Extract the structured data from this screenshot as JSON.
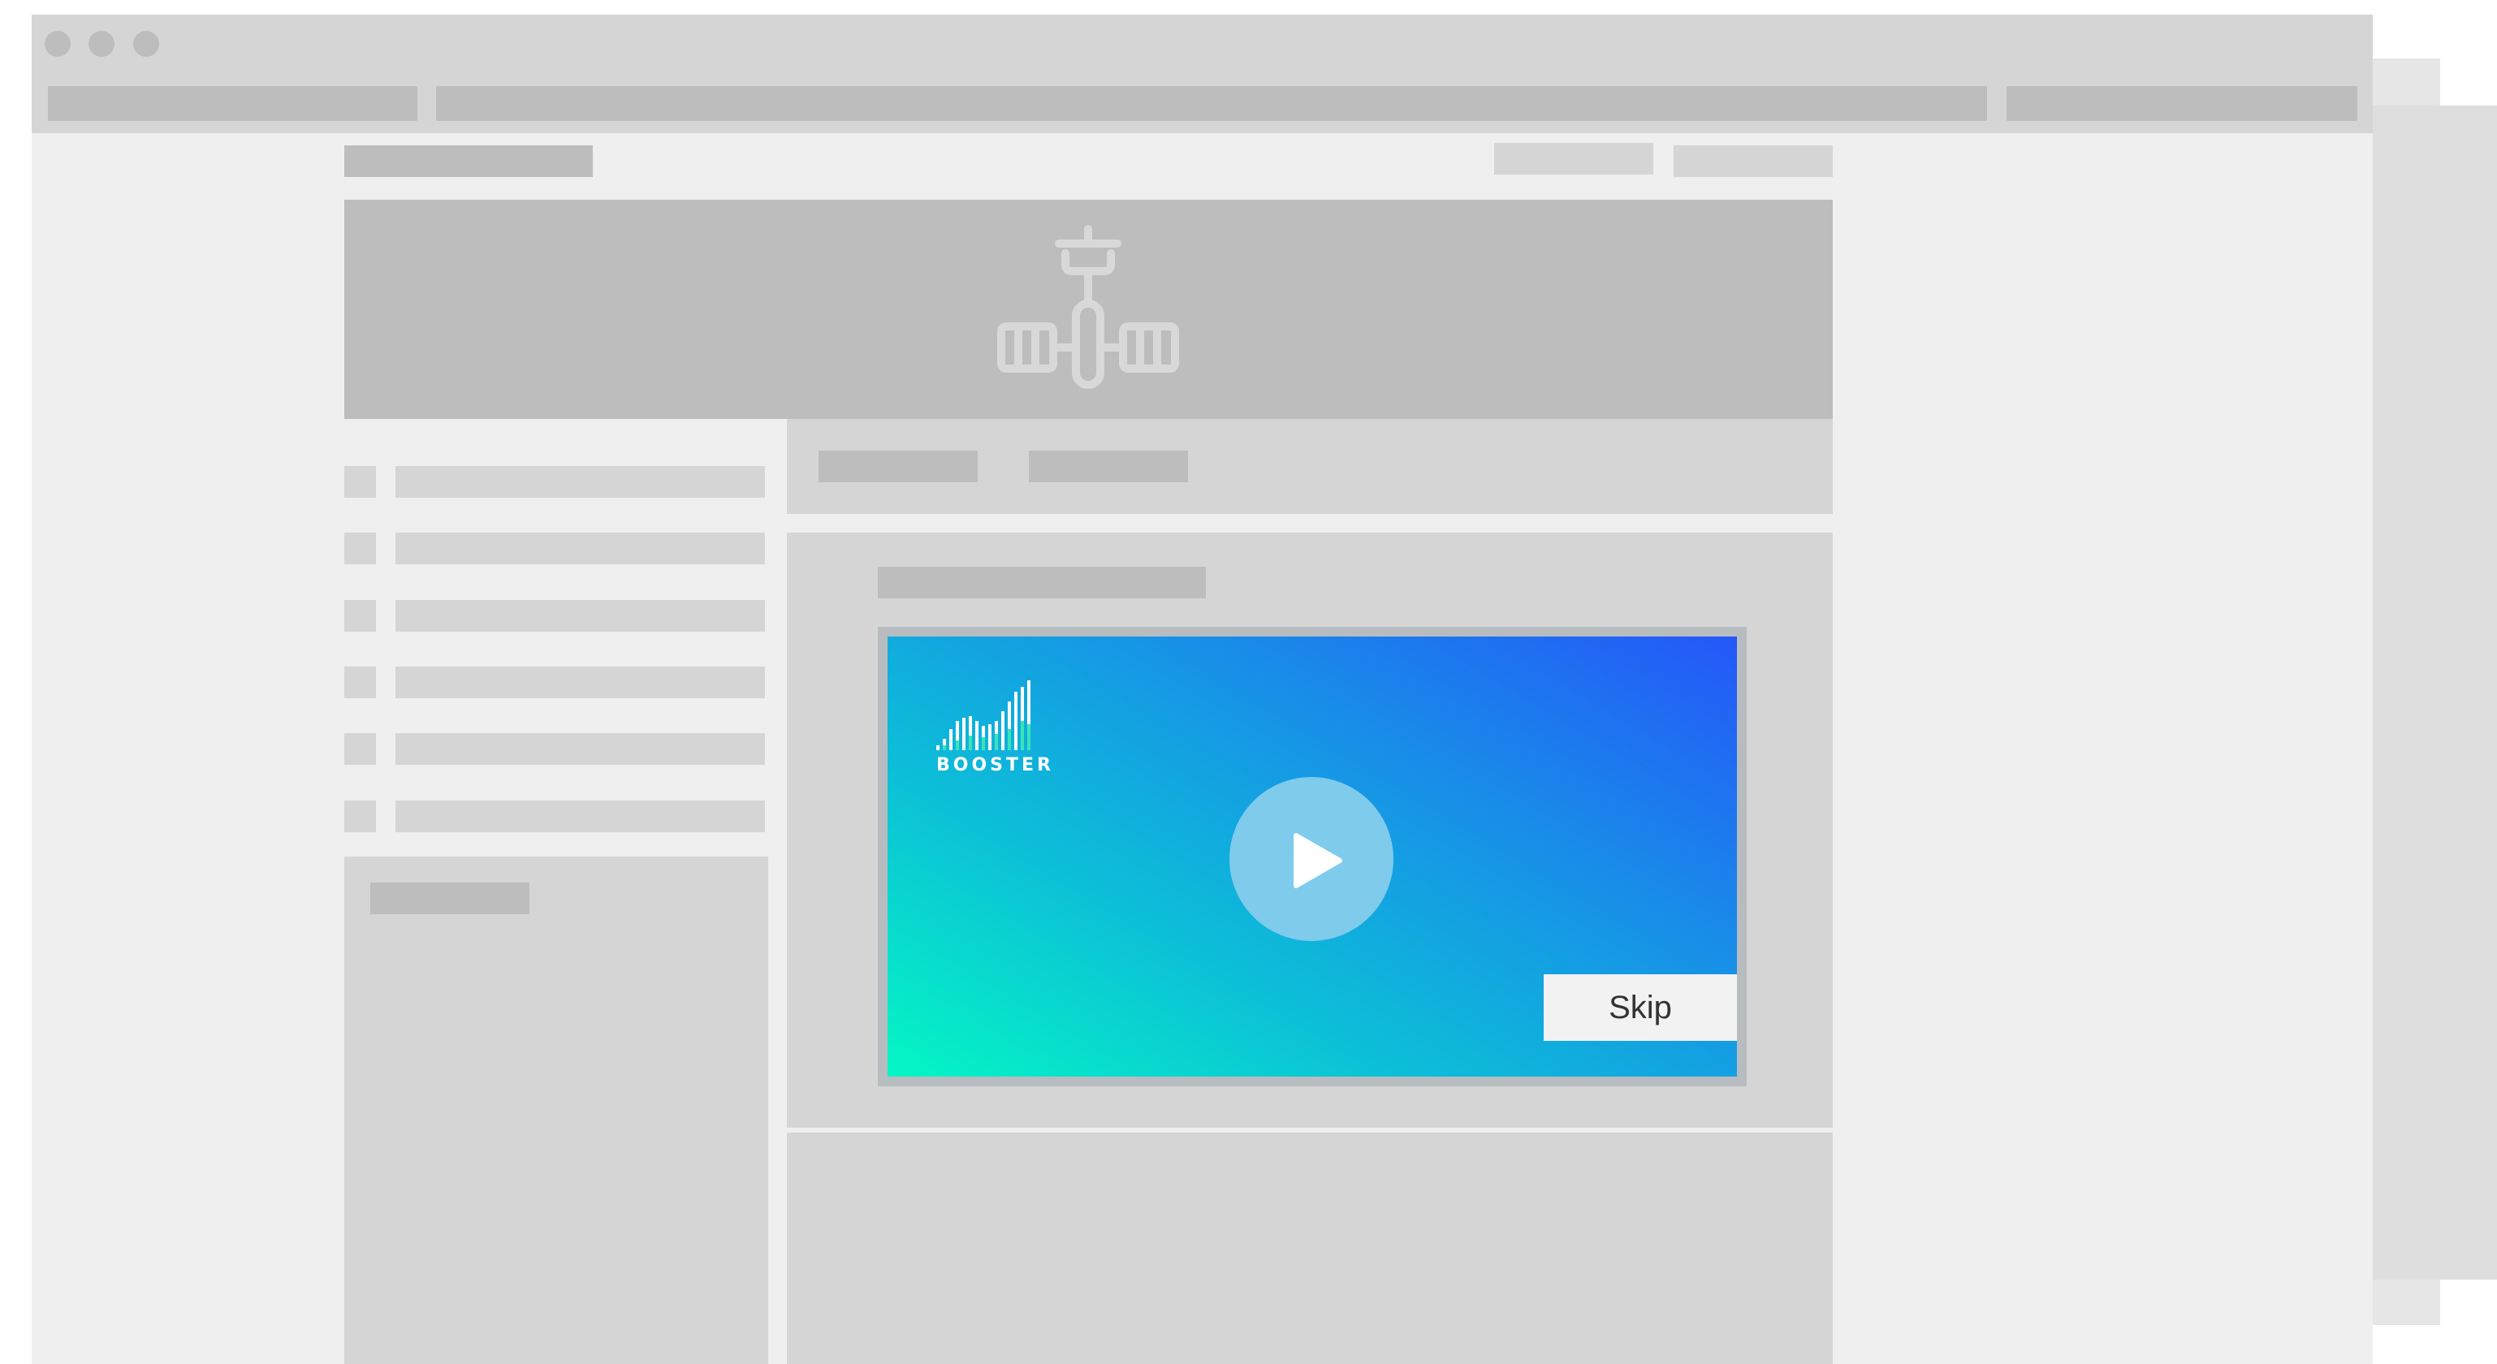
{
  "video_ad": {
    "brand": "BOOSTER",
    "play_label": "Play",
    "skip_label": "Skip"
  },
  "colors": {
    "placeholder_light": "#d5d5d5",
    "placeholder_dark": "#bdbdbd",
    "page_background": "#efefef",
    "gradient_start": "#04f7c4",
    "gradient_end": "#2557f9",
    "play_button": "#7ecbec",
    "skip_button": "#f2f2f2"
  },
  "icons": {
    "hero": "satellite-icon",
    "play": "play-icon",
    "logo": "signal-bars-icon"
  }
}
